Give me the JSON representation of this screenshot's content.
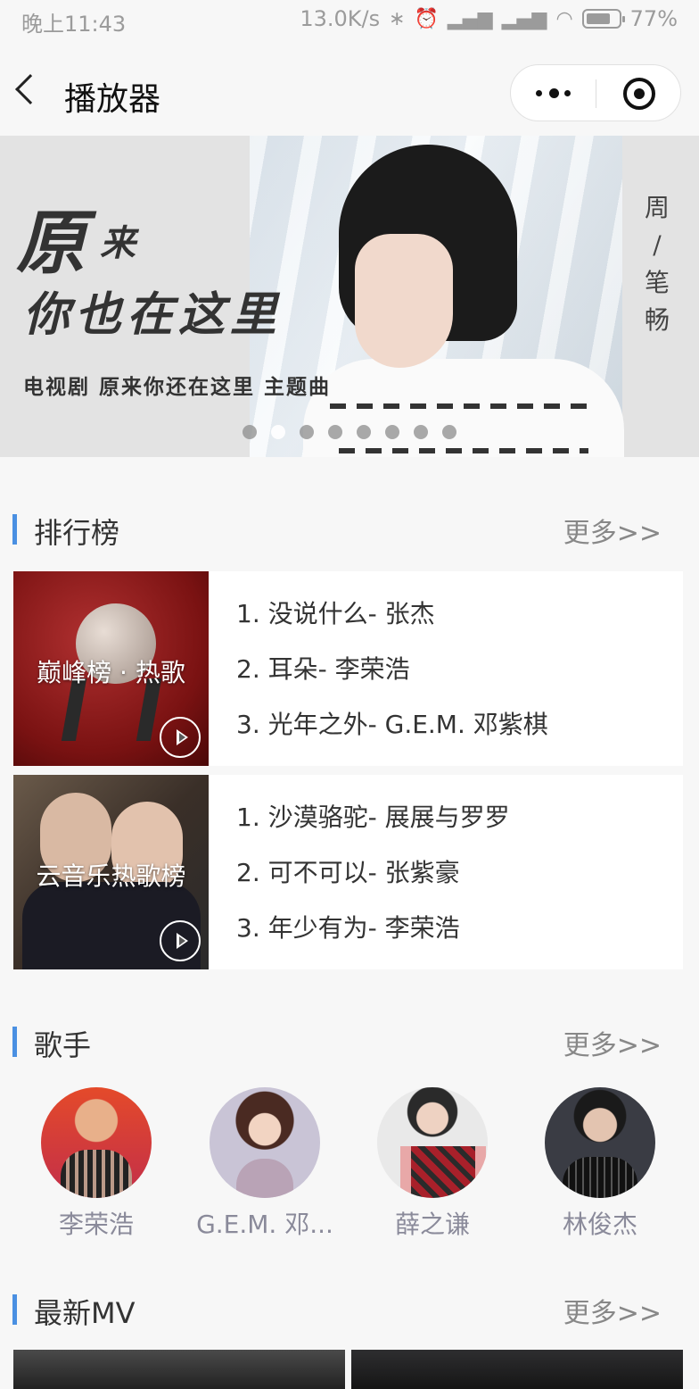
{
  "status_bar": {
    "time": "晚上11:43",
    "net_speed": "13.0K/s",
    "battery_percent": "77%",
    "battery_level": 0.77
  },
  "nav": {
    "title": "播放器"
  },
  "banner": {
    "title_big": "原",
    "title_small": "来",
    "title_line2": "你也在这里",
    "subtitle": "电视剧 原来你还在这里 主题曲",
    "side_text": [
      "周",
      "/",
      "笔",
      "畅"
    ],
    "dot_count": 8,
    "active_dot": 1
  },
  "ranking": {
    "title": "排行榜",
    "more": "更多>>",
    "charts": [
      {
        "name": "巅峰榜 · 热歌",
        "songs": [
          "1. 没说什么- 张杰",
          "2. 耳朵- 李荣浩",
          "3. 光年之外- G.E.M. 邓紫棋"
        ]
      },
      {
        "name": "云音乐热歌榜",
        "songs": [
          "1. 沙漠骆驼- 展展与罗罗",
          "2. 可不可以- 张紫豪",
          "3. 年少有为- 李荣浩"
        ]
      }
    ]
  },
  "singers": {
    "title": "歌手",
    "more": "更多>>",
    "list": [
      "李荣浩",
      "G.E.M. 邓...",
      "薛之谦",
      "林俊杰"
    ]
  },
  "mv": {
    "title": "最新MV",
    "more": "更多>>"
  },
  "colors": {
    "accent": "#4a90e2",
    "background": "#f7f7f7"
  }
}
